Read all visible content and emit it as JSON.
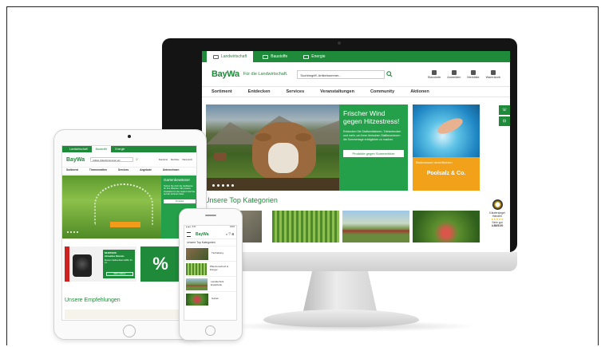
{
  "desktop": {
    "tabs": [
      "Landwirtschaft",
      "Baustoffe",
      "Energie"
    ],
    "logo": "BayWa",
    "tagline": "Für die Landwirtschaft.",
    "search_placeholder": "Suchbegriff, Artikelnummer...",
    "header_icons": [
      "Standorte",
      "Anmelden",
      "Merkliste",
      "Warenkorb"
    ],
    "nav": [
      "Sortiment",
      "Entdecken",
      "Services",
      "Veranstaltungen",
      "Community",
      "Aktionen"
    ],
    "hero_promo": {
      "title": "Frischer Wind gegen Hitzestress!",
      "body": "Entdecken Sie Stallventilatoren, Tränkebecken und mehr, um Ihren tierischen Stallbewohnern die Sommertage erträglicher zu machen.",
      "button": "Produkte gegen Sommerhitze"
    },
    "pool_banner": {
      "sub": "Badewasser desinfizieren",
      "title": "Poolsalz & Co."
    },
    "section_title": "Unsere Top Kategorien",
    "badge": {
      "line1": "Käufersiegel",
      "line2": "Händler",
      "rating_label": "Sehr gut",
      "rating": "4.85/5.00"
    },
    "accent": "#1e8a3a"
  },
  "tablet": {
    "tabs": [
      "Landwirtschaft",
      "Baustoffe",
      "Energie"
    ],
    "logo": "BayWa",
    "search_placeholder": "Artikel, Zubehörnummer etc.",
    "header_icons": [
      "Standorte",
      "Merkliste",
      "Warenkorb"
    ],
    "nav": [
      "Sortiment",
      "Themenwelten",
      "Services",
      "Angebote",
      "Unternehmen"
    ],
    "hero_promo": {
      "title": "Gartenbewässer",
      "body": "Nutzen Sie doch die Gießkanne für Ihre Pflanzen. Mit unseren Produkten für den Garten sind Sie auf der sicheren Seite.",
      "button": "Produkte"
    },
    "ad": {
      "label": "Ventilator",
      "brand": "MUNTERS",
      "title": "Aktuelles Monats",
      "body": "Munters Stallventilator EM50, 50 cm",
      "button": "Mehr erfahren"
    },
    "percent": "%",
    "section_title": "Unsere Empfehlungen"
  },
  "phone": {
    "status_left": "●●●●○ 9:41",
    "status_right": "100%",
    "logo": "BayWa",
    "header_icons": "⌕ ♡ ⊟",
    "section_title": "Unsere Top Kategorien",
    "categories": [
      "Tierhaltung",
      "Pflanzenschutz & Dünger",
      "Landtechnik Ersatzteile",
      "Garten"
    ]
  }
}
